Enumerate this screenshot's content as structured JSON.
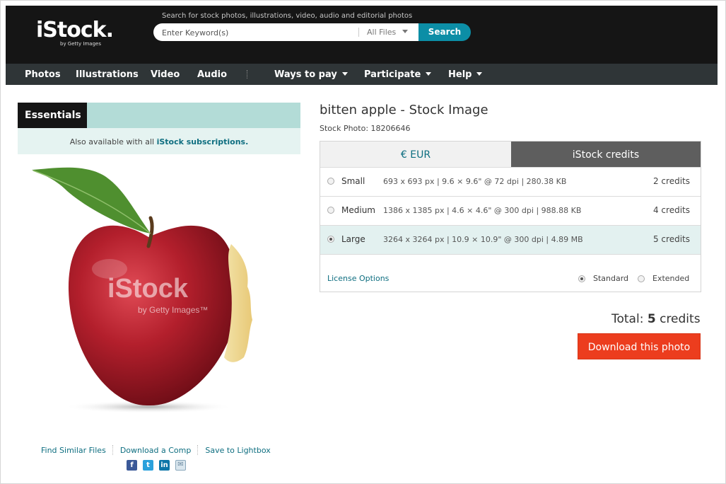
{
  "header": {
    "logo": "iStock.",
    "logo_sub": "by Getty Images",
    "search_caption": "Search for stock photos, illustrations, video, audio and editorial photos",
    "search_placeholder": "Enter Keyword(s)",
    "filter_value": "All Files",
    "search_button": "Search"
  },
  "nav": {
    "items": [
      "Photos",
      "Illustrations",
      "Video",
      "Audio"
    ],
    "menus": [
      "Ways to pay",
      "Participate",
      "Help"
    ]
  },
  "left": {
    "essentials": "Essentials",
    "availability_prefix": "Also available with all",
    "availability_link": "iStock subscriptions.",
    "watermark_main": "iStock",
    "watermark_sub": "by Getty Images™",
    "links": [
      "Find Similar Files",
      "Download a Comp",
      "Save to Lightbox"
    ],
    "share_icons": [
      "facebook-icon",
      "twitter-icon",
      "linkedin-icon",
      "email-icon"
    ]
  },
  "product": {
    "title": "bitten apple - Stock Image",
    "subtitle": "Stock Photo: 18206646",
    "tabs": [
      "€ EUR",
      "iStock credits"
    ],
    "sizes": [
      {
        "name": "Small",
        "spec": "693 x 693 px | 9.6 × 9.6\" @ 72 dpi | 280.38 KB",
        "credits": "2 credits",
        "selected": false
      },
      {
        "name": "Medium",
        "spec": "1386 x 1385 px | 4.6 × 4.6\" @ 300 dpi | 988.88 KB",
        "credits": "4 credits",
        "selected": false
      },
      {
        "name": "Large",
        "spec": "3264 x 3264 px | 10.9 × 10.9\" @ 300 dpi | 4.89 MB",
        "credits": "5 credits",
        "selected": true
      }
    ],
    "license_link": "License Options",
    "license_options": [
      "Standard",
      "Extended"
    ],
    "total_label": "Total:",
    "total_value": "5",
    "total_unit": "credits",
    "download_button": "Download this photo"
  },
  "colors": {
    "accent": "#0c8ea6",
    "link": "#0e6e80",
    "download": "#ec3d1e",
    "essentials_bg": "#b3dcd7"
  }
}
